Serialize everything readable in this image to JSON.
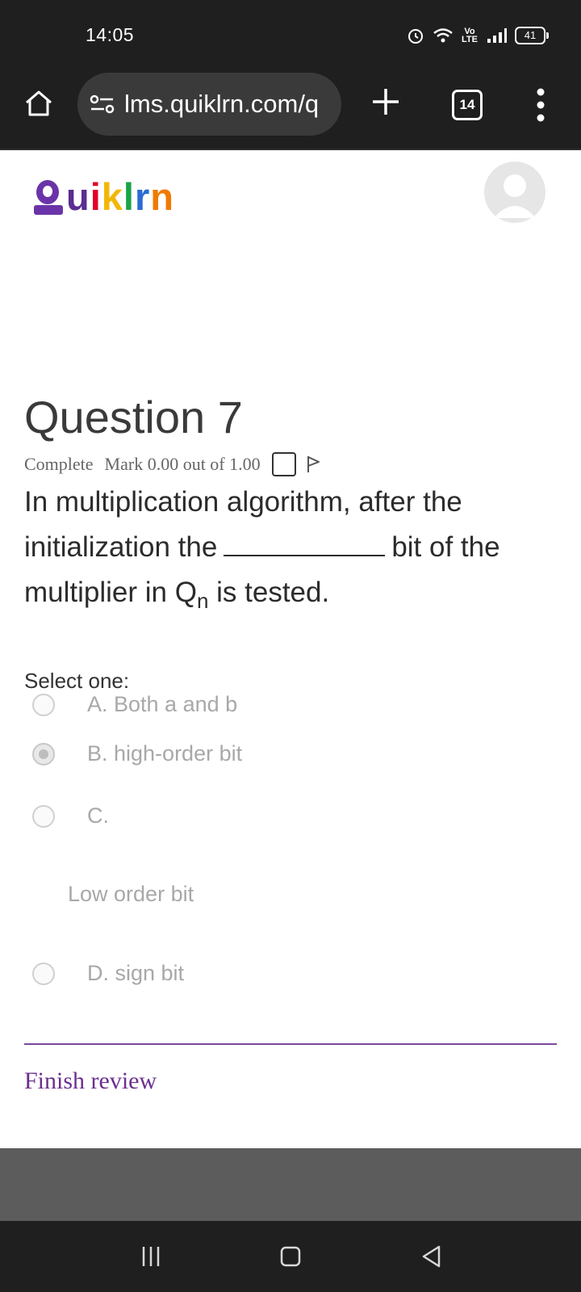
{
  "status": {
    "time": "14:05",
    "volte_top": "Vo",
    "volte_bottom": "LTE",
    "battery": "41"
  },
  "browser": {
    "url": "lms.quiklrn.com/q",
    "tab_count": "14"
  },
  "site": {
    "logo_letters": [
      {
        "char": "u",
        "color": "#5b2d90"
      },
      {
        "char": "i",
        "color": "#e4002b"
      },
      {
        "char": "k",
        "color": "#f2b705"
      },
      {
        "char": "l",
        "color": "#1aa34a"
      },
      {
        "char": "r",
        "color": "#2b6cd4"
      },
      {
        "char": "n",
        "color": "#f07a00"
      }
    ],
    "logo_q_color": "#6a34a8"
  },
  "question": {
    "title": "Question 7",
    "status": "Complete",
    "mark": "Mark 0.00 out of 1.00",
    "text_part1": "In multiplication algorithm, after the initialization the",
    "text_part2": "bit of the multiplier in Q",
    "subscript": "n",
    "text_part3": " is tested.",
    "select_label": "Select one:",
    "options": [
      {
        "label": "A. Both a and b",
        "selected": false
      },
      {
        "label": "B. high-order bit",
        "selected": true
      },
      {
        "label": "C.",
        "selected": false
      },
      {
        "label": "D. sign bit",
        "selected": false
      }
    ],
    "option_c_extra": "Low order bit"
  },
  "footer": {
    "finish_label": "Finish review"
  },
  "colors": {
    "accent": "#6b2f8f",
    "chrome_bg": "#1f1f1f"
  }
}
